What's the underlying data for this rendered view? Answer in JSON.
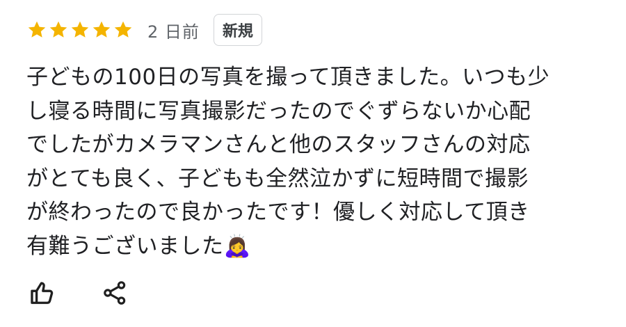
{
  "review": {
    "rating": 5,
    "max_rating": 5,
    "star_color": "#f4b400",
    "date": "2 日前",
    "badge": "新規",
    "text_lines": [
      "子どもの100日の写真を撮って頂きました。いつも少",
      "し寝る時間に写真撮影だったのでぐずらないか心配",
      "でしたがカメラマンさんと他のスタッフさんの対応",
      "がとても良く、子どもも全然泣かずに短時間で撮影",
      "が終わったので良かったです！優しく対応して頂き",
      "有難うございました🙇‍♀️"
    ]
  },
  "actions": {
    "like_icon": "thumbs-up-icon",
    "share_icon": "share-icon"
  }
}
